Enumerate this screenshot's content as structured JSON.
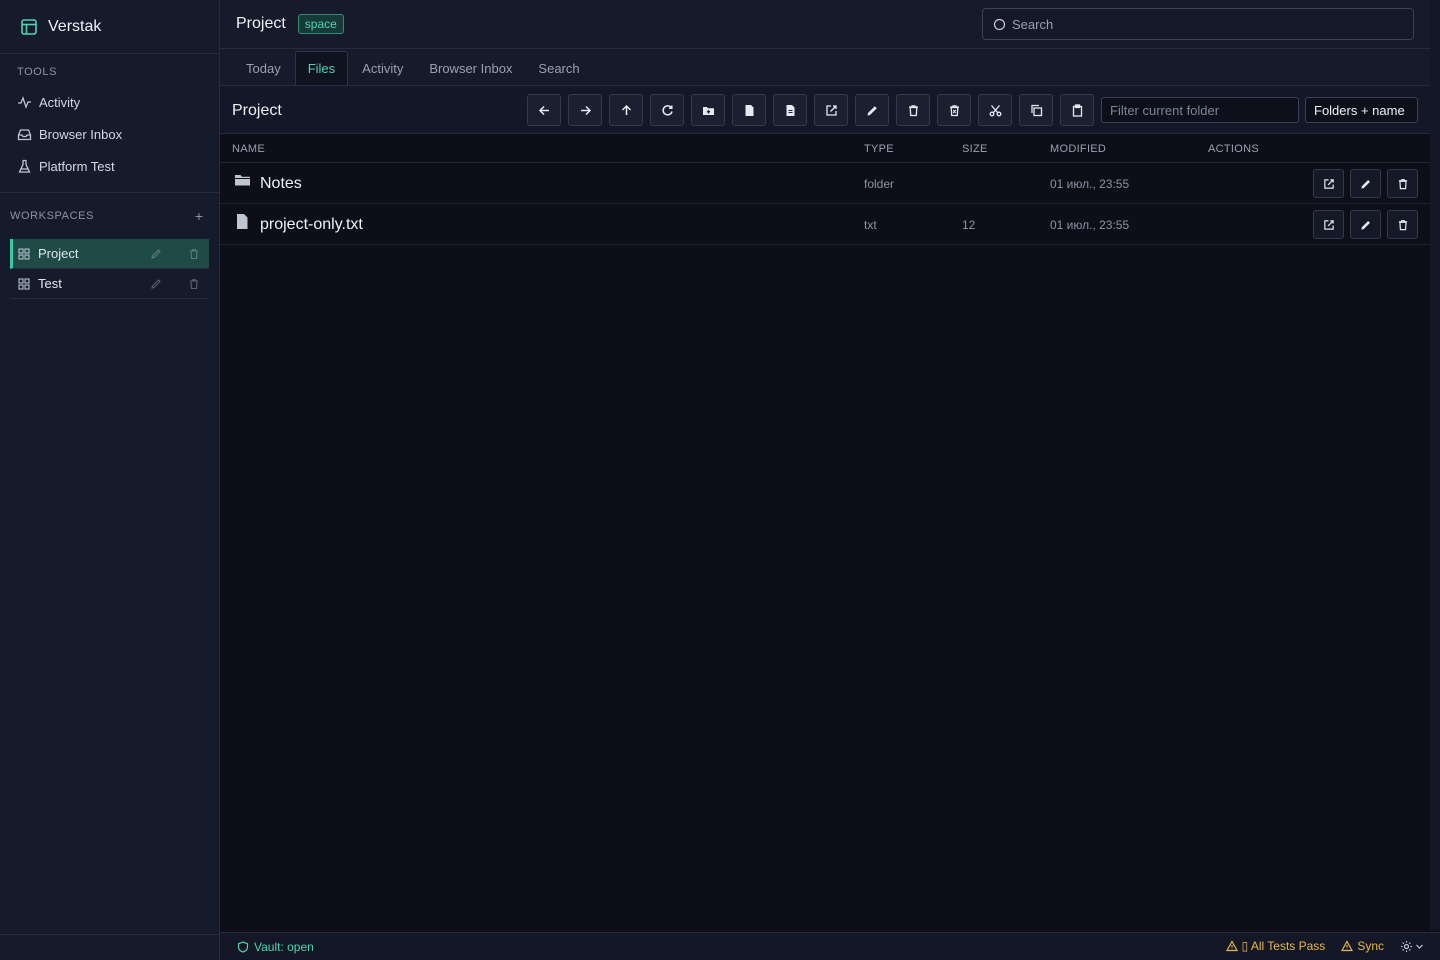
{
  "app": {
    "name": "Verstak"
  },
  "sidebar": {
    "tools_label": "TOOLS",
    "tools": [
      {
        "label": "Activity",
        "icon": "activity-icon"
      },
      {
        "label": "Browser Inbox",
        "icon": "inbox-icon"
      },
      {
        "label": "Platform Test",
        "icon": "flask-icon"
      }
    ],
    "workspaces_label": "WORKSPACES",
    "add_symbol": "+",
    "workspaces": [
      {
        "label": "Project",
        "active": true
      },
      {
        "label": "Test",
        "active": false
      }
    ]
  },
  "header": {
    "title": "Project",
    "badge": "space",
    "search_placeholder": "Search"
  },
  "tabs": [
    {
      "label": "Today",
      "active": false
    },
    {
      "label": "Files",
      "active": true
    },
    {
      "label": "Activity",
      "active": false
    },
    {
      "label": "Browser Inbox",
      "active": false
    },
    {
      "label": "Search",
      "active": false
    }
  ],
  "toolbar": {
    "folder_title": "Project",
    "filter_placeholder": "Filter current folder",
    "mode_value": "Folders + name",
    "buttons": [
      "back",
      "forward",
      "up",
      "refresh",
      "new-folder",
      "new-file",
      "new-document",
      "open-external",
      "rename",
      "delete",
      "delete-permanent",
      "cut",
      "copy",
      "paste"
    ]
  },
  "table": {
    "headers": {
      "name": "NAME",
      "type": "TYPE",
      "size": "SIZE",
      "modified": "MODIFIED",
      "actions": "ACTIONS"
    },
    "rows": [
      {
        "name": "Notes",
        "type": "folder",
        "size": "",
        "modified": "01 июл., 23:55",
        "icon": "folder-icon"
      },
      {
        "name": "project-only.txt",
        "type": "txt",
        "size": "12",
        "modified": "01 июл., 23:55",
        "icon": "file-icon"
      }
    ]
  },
  "status": {
    "vault": "Vault: open",
    "tests": "▯ All Tests Pass",
    "sync": "Sync"
  },
  "colors": {
    "accent": "#4fd4b0",
    "warning": "#e8b84a",
    "sidebar_bg": "#161b2c",
    "main_bg": "#0d0e18"
  }
}
